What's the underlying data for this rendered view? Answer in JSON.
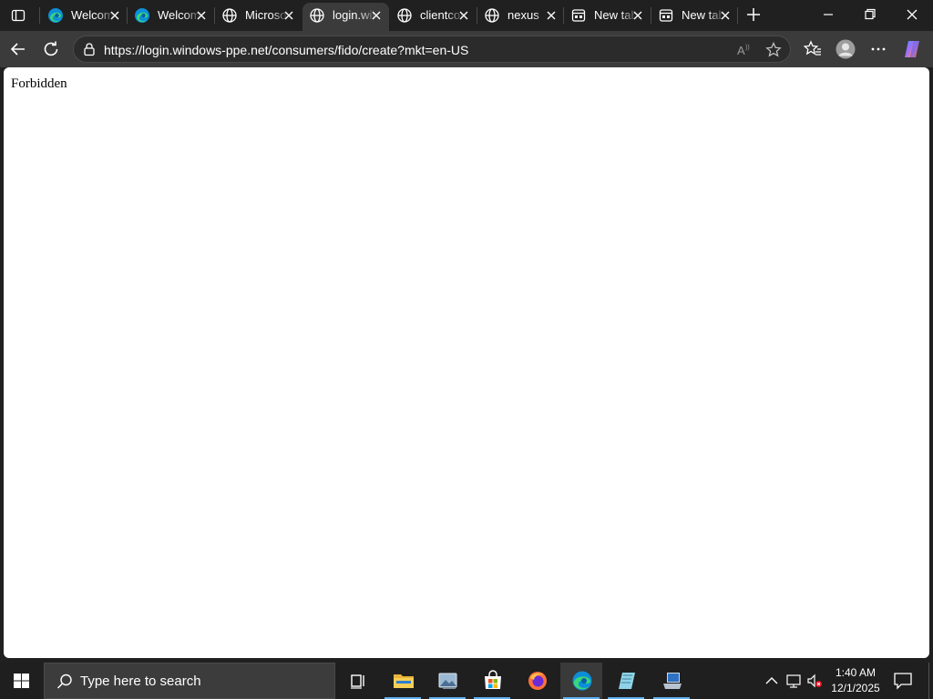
{
  "browser": {
    "tabs": [
      {
        "title": "Welcome to Microsoft Edge",
        "icon": "edge-icon",
        "active": false
      },
      {
        "title": "Welcome to Microsoft Edge",
        "icon": "edge-icon",
        "active": false
      },
      {
        "title": "Microsoft",
        "icon": "globe-icon",
        "active": false
      },
      {
        "title": "login.windows-ppe.net",
        "icon": "globe-icon",
        "active": true
      },
      {
        "title": "clientconfig",
        "icon": "globe-icon",
        "active": false
      },
      {
        "title": "nexus",
        "icon": "globe-icon",
        "active": false
      },
      {
        "title": "New tab",
        "icon": "new-tab-page-icon",
        "active": false
      },
      {
        "title": "New tab",
        "icon": "new-tab-page-icon",
        "active": false
      }
    ],
    "address_bar": {
      "url": "https://login.windows-ppe.net/consumers/fido/create?mkt=en-US"
    },
    "colors": {
      "frame": "#202020",
      "toolbar": "#3b3b3b",
      "accent": "#5fb2f2"
    }
  },
  "page": {
    "body_text": "Forbidden"
  },
  "taskbar": {
    "search_placeholder": "Type here to search",
    "apps": [
      {
        "name": "task-view-icon",
        "active": false
      },
      {
        "name": "file-explorer-icon",
        "active": false
      },
      {
        "name": "photos-icon",
        "active": false
      },
      {
        "name": "microsoft-store-icon",
        "active": false
      },
      {
        "name": "firefox-icon",
        "active": false
      },
      {
        "name": "edge-icon",
        "active": true
      },
      {
        "name": "notepad-icon",
        "active": false
      },
      {
        "name": "remote-desktop-icon",
        "active": false
      }
    ],
    "clock": {
      "time": "1:40 AM",
      "date": "12/1/2025"
    }
  }
}
